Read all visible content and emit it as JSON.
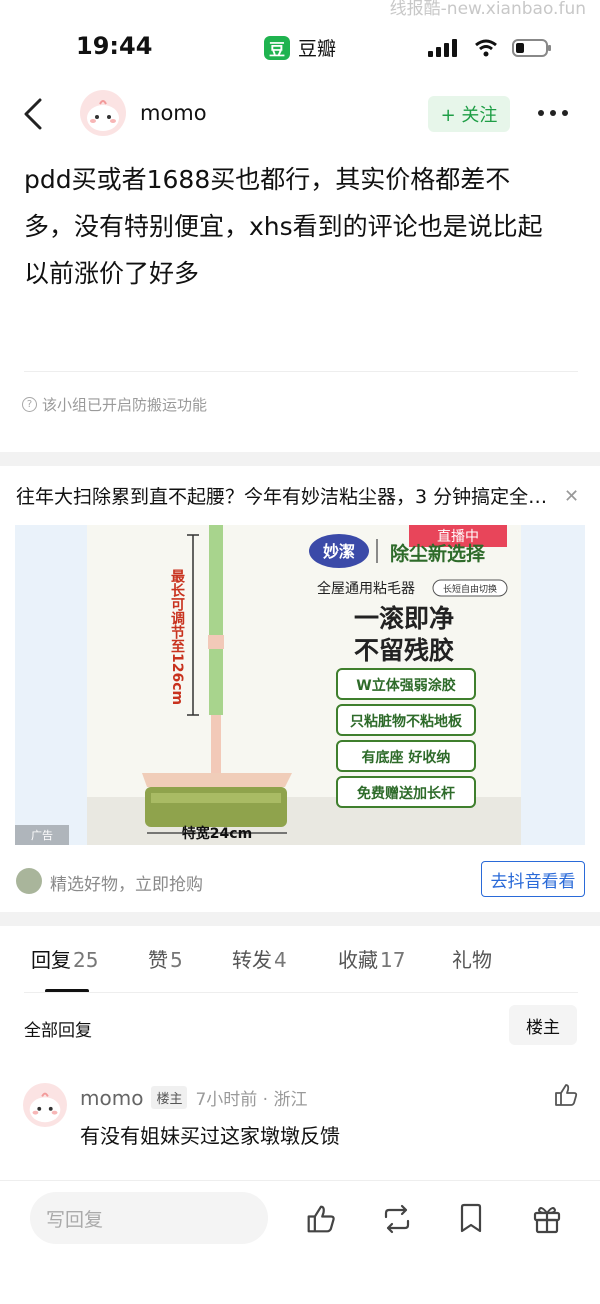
{
  "watermark": "线报酷-new.xianbao.fun",
  "status_bar": {
    "time": "19:44",
    "app_logo": "豆",
    "app_name": "豆瓣"
  },
  "header": {
    "username": "momo",
    "follow_label": "+ 关注"
  },
  "post": {
    "lines": [
      "pdd买或者1688买也都行，其实价格都差不",
      "多，没有特别便宜，xhs看到的评论也是说比起",
      "以前涨价了好多"
    ],
    "notice": "该小组已开启防搬运功能"
  },
  "ad": {
    "title": "往年大扫除累到直不起腰？今年有妙洁粘尘器，3 分钟搞定全屋…",
    "brand": "妙潔",
    "live_badge": "直播中",
    "tagline": "除尘新选择",
    "product_line": "全屋通用粘毛器",
    "mode_tag": "长短自由切换",
    "headline_1": "一滚即净",
    "headline_2": "不留残胶",
    "features": [
      "W立体强弱涂胶",
      "只粘脏物不粘地板",
      "有底座 好收纳",
      "免费赠送加长杆"
    ],
    "vertical_note": "最长可调节至126cm",
    "width_note": "特宽24cm",
    "ad_label": "广告",
    "shop_text": "精选好物，立即抢购",
    "cta": "去抖音看看"
  },
  "tabs": [
    {
      "label": "回复",
      "count": "25"
    },
    {
      "label": "赞",
      "count": "5"
    },
    {
      "label": "转发",
      "count": "4"
    },
    {
      "label": "收藏",
      "count": "17"
    },
    {
      "label": "礼物",
      "count": ""
    }
  ],
  "replies": {
    "all_label": "全部回复",
    "op_filter": "楼主"
  },
  "comment": {
    "name": "momo",
    "tag": "楼主",
    "meta": "7小时前 · 浙江",
    "text": "有没有姐妹买过这家墩墩反馈"
  },
  "bottom_bar": {
    "reply_placeholder": "写回复"
  },
  "colors": {
    "accent_green": "#1fb34f",
    "follow_bg": "#e7f6ea",
    "link_blue": "#2a6ad8"
  },
  "icons": [
    "back-icon",
    "more-icon",
    "like-icon",
    "repost-icon",
    "bookmark-icon",
    "gift-icon",
    "close-icon"
  ]
}
